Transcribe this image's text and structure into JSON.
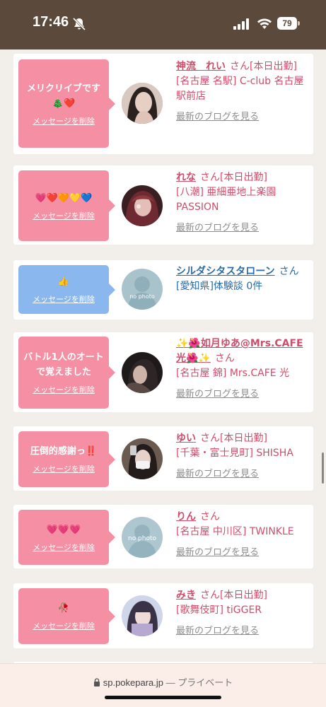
{
  "status": {
    "time": "17:46",
    "battery": "79"
  },
  "cards": [
    {
      "bubble_text": "メリクリイブです🎄❤️",
      "delete_label": "メッセージを削除",
      "name": "神流　れい",
      "san": "さん",
      "status": "[本日出勤]",
      "shop": "[名古屋 名駅] C-club 名古屋駅前店",
      "blog": "最新のブログを見る"
    },
    {
      "bubble_text": "💗❤️🧡💛💙",
      "delete_label": "メッセージを削除",
      "name": "れな",
      "san": "さん",
      "status": "[本日出勤]",
      "shop": "[八潮] 亜細亜地上楽園 PASSION",
      "blog": "最新のブログを見る"
    },
    {
      "bubble_text": "👍",
      "delete_label": "メッセージを削除",
      "name": "シルダシタスタローン",
      "san": "さん",
      "shop": "[愛知県]体験談 0件",
      "avatar_text": "no photo"
    },
    {
      "bubble_text": "バトル1人のオートで覚えました",
      "delete_label": "メッセージを削除",
      "name": "✨🌺如月ゆあ@Mrs.CAFE光🌺✨",
      "san": "さん",
      "shop": "[名古屋 錦] Mrs.CAFE 光",
      "blog": "最新のブログを見る"
    },
    {
      "bubble_text": "圧倒的感謝っ‼️",
      "delete_label": "メッセージを削除",
      "name": "ゆい",
      "san": "さん",
      "status": "[本日出勤]",
      "shop": "[千葉・富士見町] SHISHA",
      "blog": "最新のブログを見る"
    },
    {
      "bubble_text": "💗💗💗",
      "delete_label": "メッセージを削除",
      "name": "りん",
      "san": "さん",
      "shop": "[名古屋 中川区] TWINKLE",
      "blog": "最新のブログを見る",
      "avatar_text": "no photo"
    },
    {
      "bubble_text": "🥀",
      "delete_label": "メッセージを削除",
      "name": "みき",
      "san": "さん",
      "status": "[本日出勤]",
      "shop": "[歌舞伎町] tiGGER",
      "blog": "最新のブログを見る"
    }
  ],
  "urlbar": {
    "domain": "sp.pokepara.jp",
    "privacy": "— プライベート"
  },
  "colors": {
    "status_bar": "#5b4a3c",
    "bubble_pink": "#f58fa3",
    "bubble_blue": "#8ab8ee",
    "text_pink": "#d14b6a",
    "text_blue": "#2a6aa8"
  }
}
